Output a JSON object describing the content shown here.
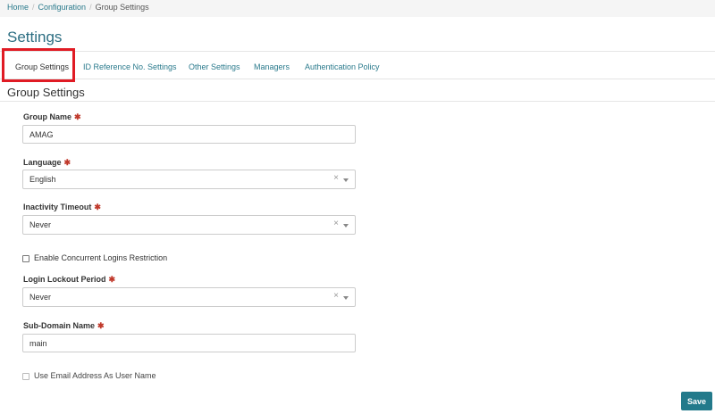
{
  "breadcrumb": {
    "home": "Home",
    "configuration": "Configuration",
    "current": "Group Settings",
    "separator": "/"
  },
  "page": {
    "title": "Settings"
  },
  "tabs": [
    {
      "label": "Group Settings",
      "active": true
    },
    {
      "label": "ID Reference No. Settings",
      "active": false
    },
    {
      "label": "Other Settings",
      "active": false
    },
    {
      "label": "Managers",
      "active": false
    },
    {
      "label": "Authentication Policy",
      "active": false
    }
  ],
  "section": {
    "title": "Group Settings"
  },
  "form": {
    "required_marker": "✱",
    "group_name": {
      "label": "Group Name",
      "value": "AMAG"
    },
    "language": {
      "label": "Language",
      "value": "English"
    },
    "inactivity_timeout": {
      "label": "Inactivity Timeout",
      "value": "Never"
    },
    "concurrent_logins": {
      "label": "Enable Concurrent Logins Restriction",
      "checked": false
    },
    "login_lockout": {
      "label": "Login Lockout Period",
      "value": "Never"
    },
    "sub_domain": {
      "label": "Sub-Domain Name",
      "value": "main"
    },
    "email_as_username": {
      "label": "Use Email Address As User Name",
      "checked": false,
      "disabled": true
    }
  },
  "actions": {
    "save_label": "Save"
  },
  "colors": {
    "accent": "#237a8b",
    "link": "#2a7a8c",
    "title": "#2c6e82",
    "required": "#c0392b",
    "highlight": "#e01b24"
  },
  "icons": {
    "clear": "×",
    "caret": "chevron-down-icon"
  }
}
